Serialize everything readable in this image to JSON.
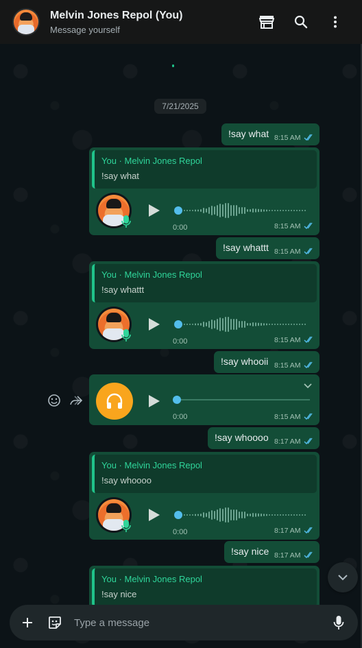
{
  "header": {
    "title": "Melvin Jones Repol (You)",
    "subtitle": "Message yourself",
    "icons": [
      "shop-icon",
      "search-icon",
      "more-vert-icon"
    ]
  },
  "chat": {
    "date": "7/21/2025",
    "messages": [
      {
        "type": "text",
        "text": "!say what",
        "time": "8:15 AM"
      },
      {
        "type": "voice_reply",
        "quote_name": "You · Melvin Jones Repol",
        "quote_text": "!say what",
        "duration": "0:00",
        "time": "8:15 AM"
      },
      {
        "type": "text",
        "text": "!say whattt",
        "time": "8:15 AM"
      },
      {
        "type": "voice_reply",
        "quote_name": "You · Melvin Jones Repol",
        "quote_text": "!say whattt",
        "duration": "0:00",
        "time": "8:15 AM"
      },
      {
        "type": "text",
        "text": "!say whooii",
        "time": "8:15 AM"
      },
      {
        "type": "audio",
        "duration": "0:00",
        "time": "8:15 AM"
      },
      {
        "type": "text",
        "text": "!say whoooo",
        "time": "8:17 AM"
      },
      {
        "type": "voice_reply",
        "quote_name": "You · Melvin Jones Repol",
        "quote_text": "!say whoooo",
        "duration": "0:00",
        "time": "8:17 AM"
      },
      {
        "type": "text",
        "text": "!say nice",
        "time": "8:17 AM"
      },
      {
        "type": "quote_partial",
        "quote_name": "You · Melvin Jones Repol",
        "quote_text": "!say nice"
      }
    ]
  },
  "composer": {
    "placeholder": "Type a message"
  },
  "colors": {
    "outgoing_bubble": "#134d37",
    "accent": "#2fd59a",
    "read_ticks": "#53bdeb",
    "audio_icon_bg": "#f9a51d"
  }
}
